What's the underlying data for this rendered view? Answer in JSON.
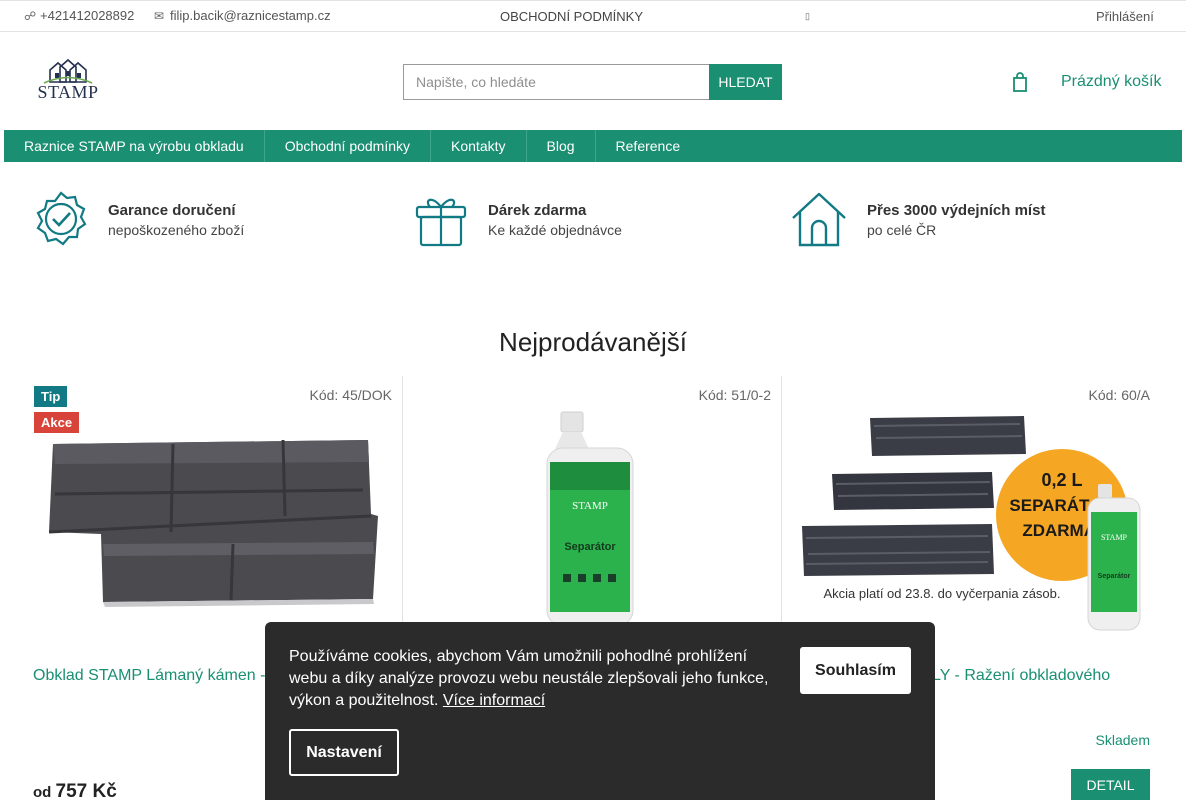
{
  "topbar": {
    "phone": "+421412028892",
    "phone_icon": "phone-icon",
    "email": "filip.bacik@raznicestamp.cz",
    "email_icon": "envelope-icon",
    "terms": "OBCHODNÍ PODMÍNKY",
    "flag_icon": "language-flag-icon",
    "login": "Přihlášení"
  },
  "header": {
    "logo_text": "STAMP",
    "search_placeholder": "Napište, co hledáte",
    "search_button": "HLEDAT",
    "cart_icon": "cart-icon",
    "cart_label": "Prázdný košík"
  },
  "nav": {
    "items": [
      "Raznice STAMP na výrobu obkladu",
      "Obchodní podmínky",
      "Kontakty",
      "Blog",
      "Reference"
    ]
  },
  "benefits": [
    {
      "icon": "verified-badge-icon",
      "title": "Garance doručení",
      "subtitle": "nepoškozeného zboží"
    },
    {
      "icon": "gift-icon",
      "title": "Dárek zdarma",
      "subtitle": "Ke každé objednávce"
    },
    {
      "icon": "house-icon",
      "title": "Přes 3000 výdejních míst",
      "subtitle": "po celé ČR"
    }
  ],
  "section_title": "Nejprodávanější",
  "products": [
    {
      "code": "Kód: 45/DOK",
      "badge_tip": "Tip",
      "badge_sale": "Akce",
      "name": "Obklad STAMP Lámaný kámen -",
      "price_prefix": "od",
      "price": "757 Kč"
    },
    {
      "code": "Kód: 51/0-2",
      "bottle_brand": "STAMP",
      "bottle_label": "Separátor"
    },
    {
      "code": "Kód: 60/A",
      "name": "LY - Ražení obkladového",
      "stock": "Skladem",
      "detail_button": "DETAIL",
      "promo_line1": "0,2 L",
      "promo_line2": "SEPARÁTOR",
      "promo_line3": "ZDARMA!",
      "promo_note": "Akcia platí od 23.8. do vyčerpania zásob.",
      "bottle_brand": "STAMP",
      "bottle_label": "Separátor"
    }
  ],
  "cookie": {
    "message": "Používáme cookies, abychom Vám umožnili pohodlné prohlížení webu a díky analýze provozu webu neustále zlepšovali jeho funkce, výkon a použitelnost.",
    "more_link": "Více informací",
    "accept": "Souhlasím",
    "settings": "Nastavení"
  },
  "colors": {
    "accent": "#1a8f72",
    "badge_tip": "#127a84",
    "badge_sale": "#d9443a",
    "cookie_bg": "#2b2b2b"
  }
}
